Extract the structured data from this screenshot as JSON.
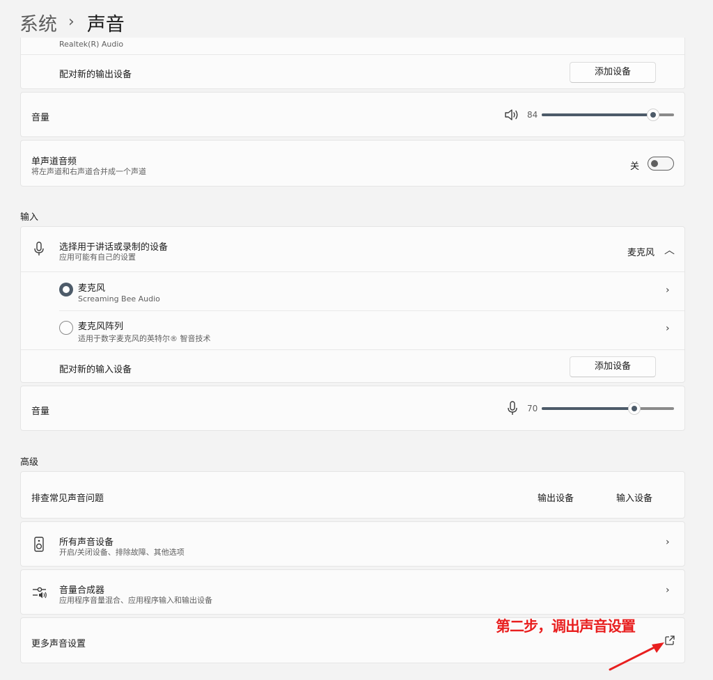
{
  "breadcrumb": {
    "parent": "系统",
    "separator": "›",
    "current": "声音"
  },
  "output": {
    "device_name": "Realtek(R) Audio",
    "pair_label": "配对新的输出设备",
    "add_device_button": "添加设备",
    "volume_label": "音量",
    "volume_value": 84,
    "mono": {
      "title": "单声道音频",
      "subtitle": "将左声道和右声道合并成一个声道",
      "state": "关",
      "on": false
    }
  },
  "input": {
    "section_title": "输入",
    "select_title": "选择用于讲话或录制的设备",
    "select_subtitle": "应用可能有自己的设置",
    "selected_device": "麦克风",
    "devices": [
      {
        "name": "麦克风",
        "detail": "Screaming Bee Audio",
        "selected": true
      },
      {
        "name": "麦克风阵列",
        "detail": "适用于数字麦克风的英特尔® 智音技术",
        "selected": false
      }
    ],
    "pair_label": "配对新的输入设备",
    "add_device_button": "添加设备",
    "volume_label": "音量",
    "volume_value": 70
  },
  "advanced": {
    "section_title": "高级",
    "troubleshoot": {
      "title": "排查常见声音问题",
      "output_link": "输出设备",
      "input_link": "输入设备"
    },
    "all_devices": {
      "title": "所有声音设备",
      "subtitle": "开启/关闭设备、排除故障、其他选项"
    },
    "mixer": {
      "title": "音量合成器",
      "subtitle": "应用程序音量混合、应用程序输入和输出设备"
    },
    "more_settings": {
      "title": "更多声音设置"
    }
  },
  "annotation": {
    "text": "第二步，调出声音设置",
    "color": "#e81f1f"
  },
  "colors": {
    "accent": "#4d5b69",
    "background": "#f3f3f3",
    "card": "#fbfbfb"
  },
  "icons": {
    "volume": "speaker-volume-icon",
    "microphone": "microphone-icon",
    "speaker_device": "speaker-device-icon",
    "mixer": "mixer-icon",
    "external": "open-external-icon"
  }
}
